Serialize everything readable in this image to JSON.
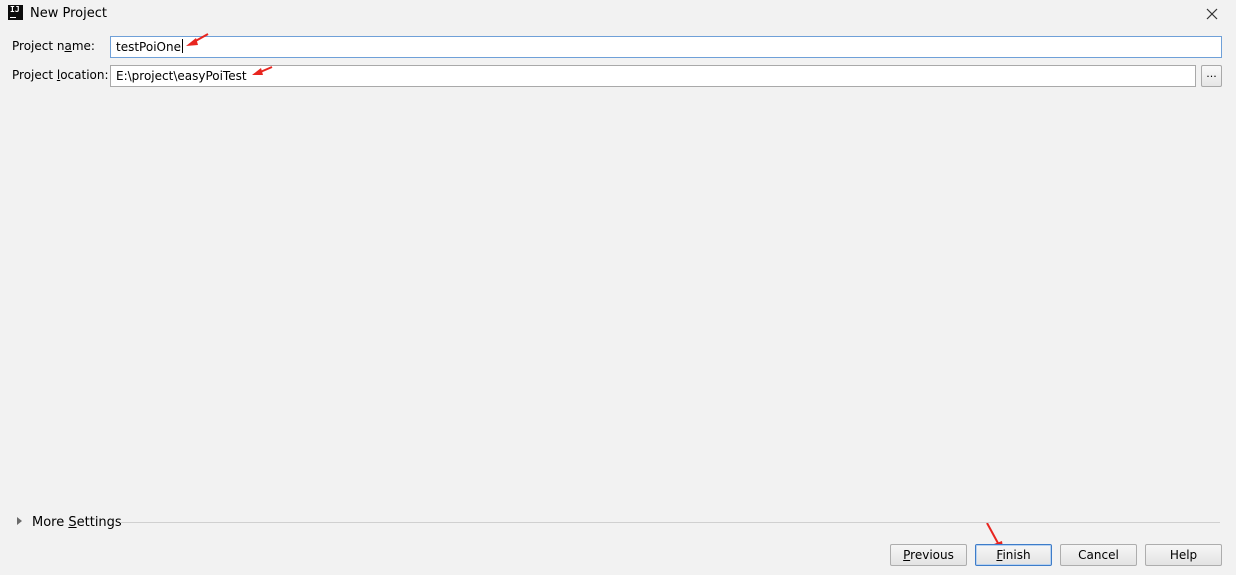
{
  "window": {
    "title": "New Project",
    "app_icon_text": "IJ"
  },
  "form": {
    "project_name": {
      "label_pre": "Project n",
      "label_mnemonic": "a",
      "label_post": "me:",
      "value": "testPoiOne"
    },
    "project_location": {
      "label_pre": "Project ",
      "label_mnemonic": "l",
      "label_post": "ocation:",
      "value": "E:\\project\\easyPoiTest",
      "browse_label": "..."
    }
  },
  "more_settings": {
    "label_pre": "More ",
    "label_mnemonic": "S",
    "label_post": "ettings",
    "expanded": false
  },
  "buttons": {
    "previous": {
      "mnemonic": "P",
      "rest": "revious"
    },
    "finish": {
      "mnemonic": "F",
      "rest": "inish"
    },
    "cancel": {
      "label": "Cancel"
    },
    "help": {
      "label": "Help"
    }
  },
  "colors": {
    "background": "#f2f2f2",
    "focus_border": "#6fa0d8",
    "annotation_arrow": "#e8251f"
  }
}
